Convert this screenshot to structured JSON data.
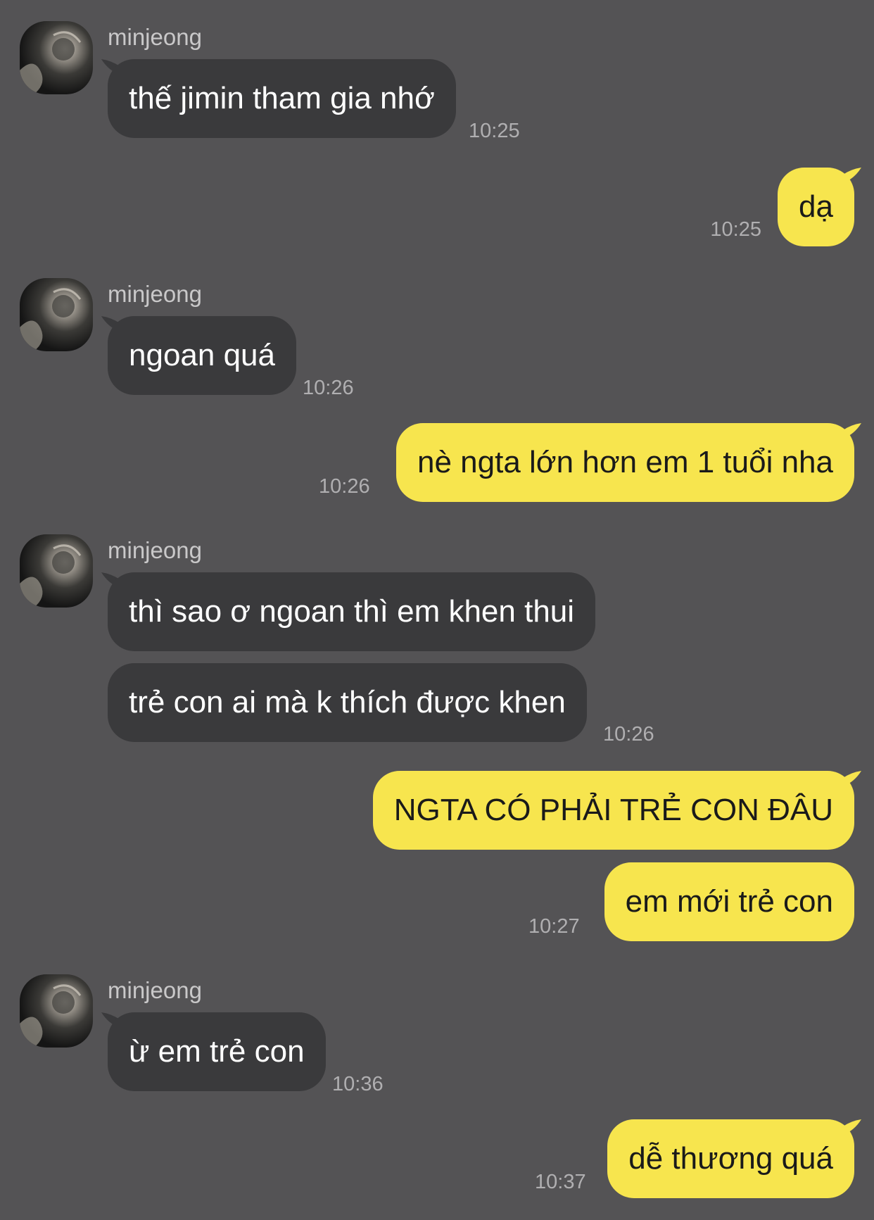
{
  "contact": {
    "name": "minjeong"
  },
  "colors": {
    "background": "#545355",
    "incoming_bubble": "#3a3a3c",
    "outgoing_bubble": "#f7e54e",
    "sender_name": "#c9c8c9",
    "timestamp": "#b0afb1"
  },
  "messages": [
    {
      "direction": "in",
      "sender": "minjeong",
      "text": "thế jimin tham gia nhớ",
      "time": "10:25"
    },
    {
      "direction": "out",
      "text": "dạ",
      "time": "10:25"
    },
    {
      "direction": "in",
      "sender": "minjeong",
      "text": "ngoan quá",
      "time": "10:26"
    },
    {
      "direction": "out",
      "text": "nè ngta lớn hơn em 1 tuổi nha",
      "time": "10:26"
    },
    {
      "direction": "in",
      "sender": "minjeong",
      "text": "thì sao ơ ngoan thì em khen thui",
      "time": ""
    },
    {
      "direction": "in",
      "text": "trẻ con ai mà k thích được khen",
      "time": "10:26"
    },
    {
      "direction": "out",
      "text": "NGTA CÓ PHẢI TRẺ CON ĐÂU",
      "time": ""
    },
    {
      "direction": "out",
      "text": "em mới trẻ con",
      "time": "10:27"
    },
    {
      "direction": "in",
      "sender": "minjeong",
      "text": "ừ em trẻ con",
      "time": "10:36"
    },
    {
      "direction": "out",
      "text": "dễ thương quá",
      "time": "10:37"
    }
  ]
}
